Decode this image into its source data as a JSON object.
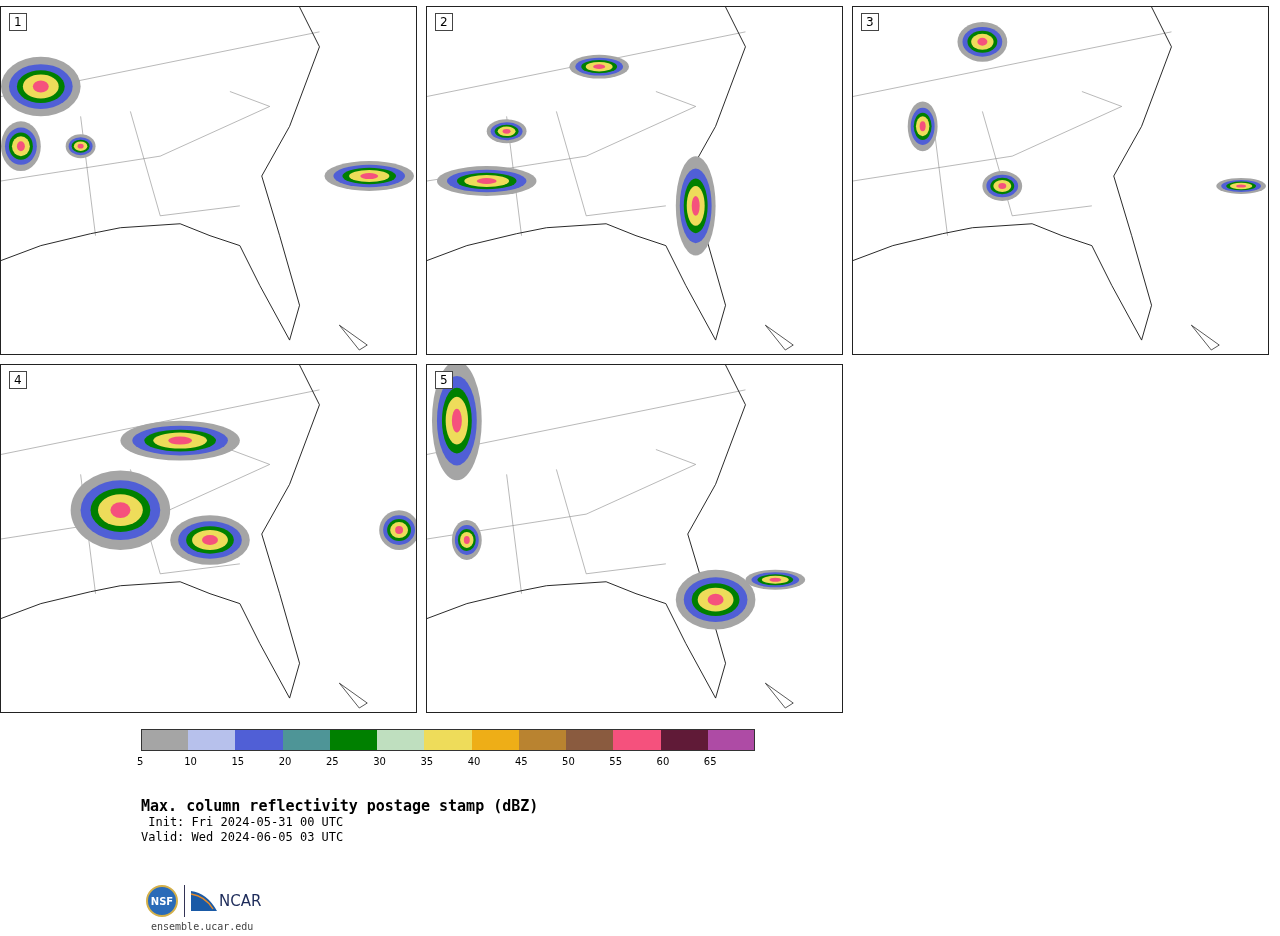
{
  "panels": [
    {
      "label": "1"
    },
    {
      "label": "2"
    },
    {
      "label": "3"
    },
    {
      "label": "4"
    },
    {
      "label": "5"
    }
  ],
  "colorbar": [
    {
      "color": "#a5a5a5",
      "tick": "5"
    },
    {
      "color": "#b7c1ec",
      "tick": "10"
    },
    {
      "color": "#505fd6",
      "tick": "15"
    },
    {
      "color": "#4e9597",
      "tick": "20"
    },
    {
      "color": "#008000",
      "tick": "25"
    },
    {
      "color": "#bfdfbf",
      "tick": "30"
    },
    {
      "color": "#eedc5a",
      "tick": "35"
    },
    {
      "color": "#eeae17",
      "tick": "40"
    },
    {
      "color": "#b98330",
      "tick": "45"
    },
    {
      "color": "#8a5b3f",
      "tick": "50"
    },
    {
      "color": "#f5517d",
      "tick": "55"
    },
    {
      "color": "#601a37",
      "tick": "60"
    },
    {
      "color": "#ae4ba5",
      "tick": "65"
    }
  ],
  "title": "Max. column reflectivity postage stamp (dBZ)",
  "init": " Init: Fri 2024-05-31 00 UTC",
  "valid": "Valid: Wed 2024-06-05 03 UTC",
  "logos": {
    "nsf": "NSF",
    "ncar": "NCAR"
  },
  "url": "ensemble.ucar.edu"
}
